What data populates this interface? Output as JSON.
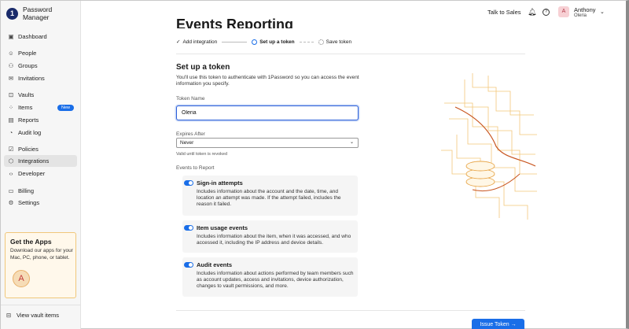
{
  "app": {
    "name": "Password Manager",
    "logo_glyph": "1"
  },
  "sidebar": {
    "items": [
      {
        "label": "Dashboard",
        "icon": "dashboard-icon",
        "glyph": "▣"
      },
      {
        "label": "People",
        "icon": "person-icon",
        "glyph": "☺"
      },
      {
        "label": "Groups",
        "icon": "groups-icon",
        "glyph": "⚇"
      },
      {
        "label": "Invitations",
        "icon": "envelope-icon",
        "glyph": "✉"
      },
      {
        "label": "Vaults",
        "icon": "vault-icon",
        "glyph": "⊡"
      },
      {
        "label": "Items",
        "icon": "items-icon",
        "glyph": "⁘",
        "badge": "New"
      },
      {
        "label": "Reports",
        "icon": "report-icon",
        "glyph": "▤"
      },
      {
        "label": "Audit log",
        "icon": "audit-icon",
        "glyph": "◔"
      },
      {
        "label": "Policies",
        "icon": "policy-icon",
        "glyph": "☑"
      },
      {
        "label": "Integrations",
        "icon": "integrations-icon",
        "glyph": "⬡"
      },
      {
        "label": "Developer",
        "icon": "code-icon",
        "glyph": "‹›"
      },
      {
        "label": "Billing",
        "icon": "billing-icon",
        "glyph": "▭"
      },
      {
        "label": "Settings",
        "icon": "gear-icon",
        "glyph": "⚙"
      }
    ],
    "active": "Integrations",
    "get_apps": {
      "title": "Get the Apps",
      "text": "Download our apps for your Mac, PC, phone, or tablet."
    },
    "view_vault": "View vault items"
  },
  "header": {
    "talk_to_sales": "Talk to Sales",
    "user_name": "Anthony",
    "user_sub": "Oleria",
    "avatar_letter": "A"
  },
  "page": {
    "title": "Events Reporting",
    "steps": [
      {
        "label": "Add integration",
        "state": "done"
      },
      {
        "label": "Set up a token",
        "state": "current"
      },
      {
        "label": "Save token",
        "state": "pending"
      }
    ],
    "section_title": "Set up a token",
    "section_desc": "You'll use this token to authenticate with 1Password so you can access the event information you specify.",
    "token_label": "Token Name",
    "token_value": "Oleria",
    "expires_label": "Expires After",
    "expires_value": "Never",
    "expires_hint": "Valid until token is revoked",
    "events_label": "Events to Report",
    "events": [
      {
        "title": "Sign-in attempts",
        "desc": "Includes information about the account and the date, time, and location an attempt was made. If the attempt failed, includes the reason it failed.",
        "enabled": true
      },
      {
        "title": "Item usage events",
        "desc": "Includes information about the item, when it was accessed, and who accessed it, including the IP address and device details.",
        "enabled": true
      },
      {
        "title": "Audit events",
        "desc": "Includes information about actions performed by team members such as account updates, access and invitations, device authorization, changes to vault permissions, and more.",
        "enabled": true
      }
    ],
    "issue_button": "Issue Token →"
  },
  "colors": {
    "accent": "#1a6ee8",
    "art_light": "#f3c77a",
    "art_dark": "#c8551f"
  }
}
